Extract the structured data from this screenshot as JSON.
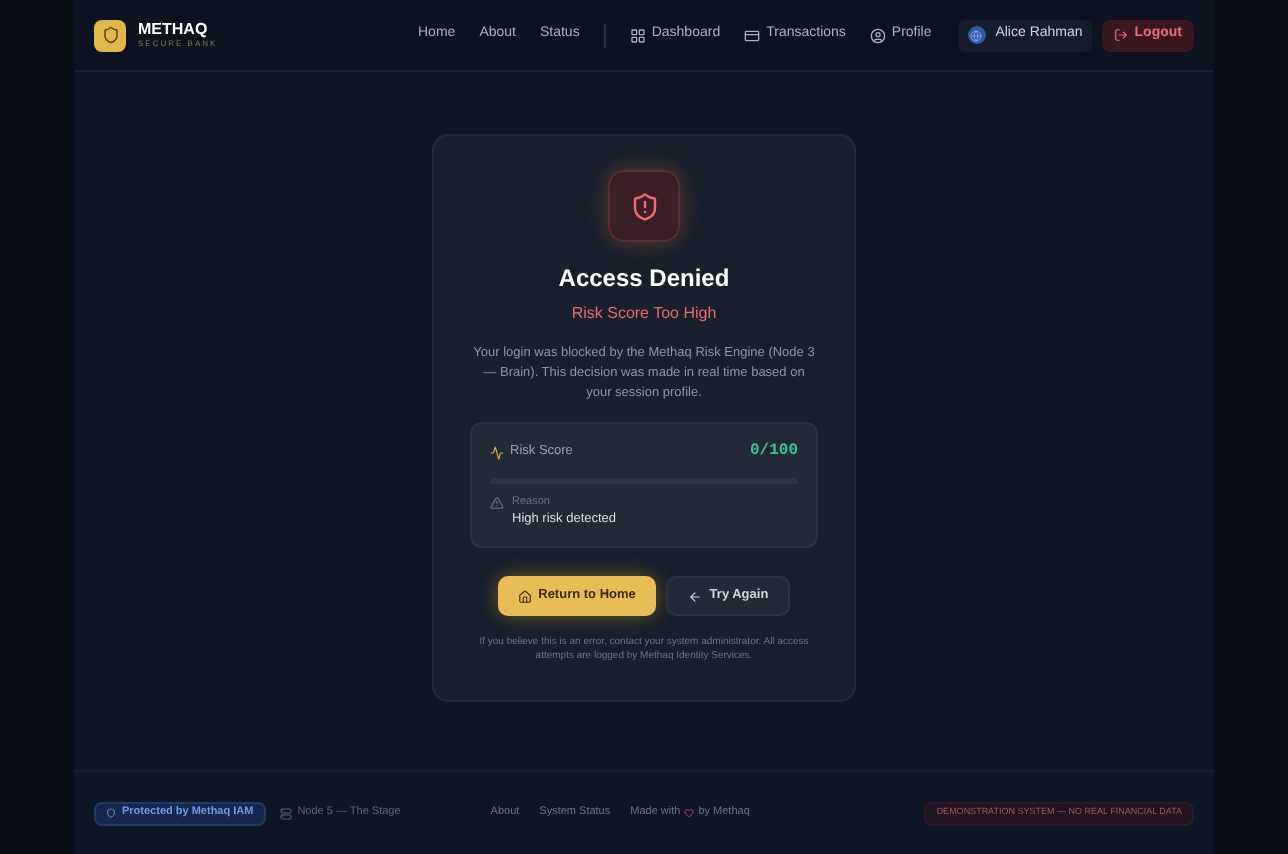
{
  "brand": {
    "name": "METHAQ",
    "tagline": "SECURE BANK"
  },
  "nav": [
    {
      "label": "Home",
      "kind": "text"
    },
    {
      "label": "About",
      "kind": "text"
    },
    {
      "label": "Status",
      "kind": "text"
    },
    {
      "label": "Dashboard",
      "kind": "dashboard"
    },
    {
      "label": "Transactions",
      "kind": "transactions"
    },
    {
      "label": "Profile",
      "kind": "profile"
    }
  ],
  "user": {
    "name": "Alice Rahman"
  },
  "logout": "Logout",
  "card": {
    "title": "Access Denied",
    "subtitle": "Risk Score Too High",
    "message": "Your login was blocked by the Methaq Risk Engine (Node 3 — Brain). This decision was made in real time based on your session profile.",
    "risk": {
      "label": "Risk Score",
      "reading": "0/100",
      "level": 0
    },
    "reason": {
      "label": "Reason",
      "value": "High risk detected"
    },
    "primary": "Return to Home",
    "secondary": "Try Again",
    "note": "If you believe this is an error, contact your system administrator. All access attempts are logged by Methaq Identity Services."
  },
  "footer": {
    "badge": "Protected by Methaq IAM",
    "node": "Node 5 — The Stage",
    "links": [
      "About",
      "System Status"
    ],
    "made_before": "Made with",
    "made_after": "by Methaq",
    "disclaimer": "DEMONSTRATION SYSTEM — NO REAL FINANCIAL DATA"
  }
}
